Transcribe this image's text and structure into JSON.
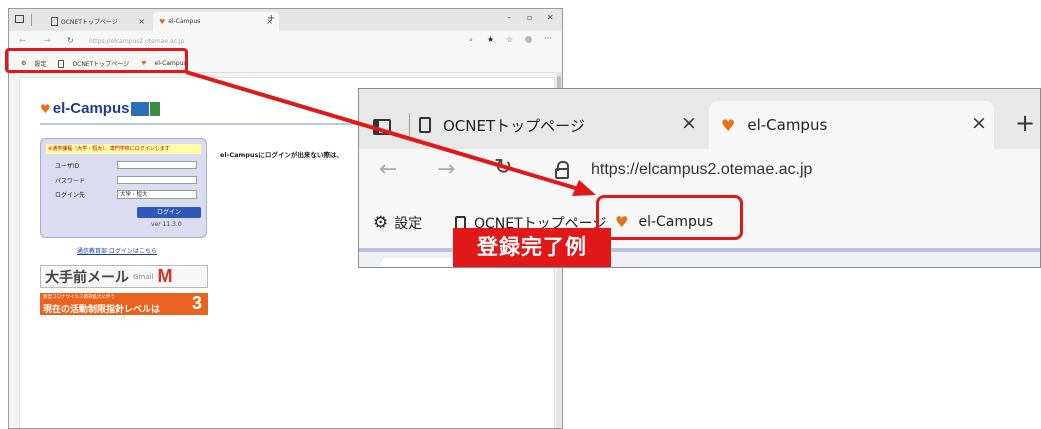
{
  "background_browser": {
    "tabs": [
      {
        "label": "OCNETトップページ"
      },
      {
        "label": "el-Campus"
      }
    ],
    "close_glyph": "×",
    "new_tab_glyph": "+",
    "address": "https://elcampus2.otemae.ac.jp",
    "favorites": [
      {
        "label": "設定",
        "icon": "gear-icon"
      },
      {
        "label": "OCNETトップページ",
        "icon": "page-icon"
      },
      {
        "label": "el-Campus",
        "icon": "el-campus-icon"
      }
    ]
  },
  "elcampus_page": {
    "logo_text": "el-Campus",
    "login": {
      "note": "※通学課程（大学・短大）、専門学校にログインします",
      "user_id_label": "ユーザID",
      "password_label": "パスワード",
      "destination_label": "ログイン先",
      "destination_value": "大学・短大",
      "login_button": "ログイン",
      "version": "ver 11.3.0"
    },
    "right_message": "el-Campusにログインが出来ない際は、",
    "tsushin_link": "通信教育部 ログインはこちら",
    "mail_banner": {
      "title": "大手前メール",
      "gmail": "Gmail",
      "icon": "gmail-icon"
    },
    "covid_banner": {
      "small": "新型コロナウイルス感染拡大に伴う",
      "big": "現在の活動制限指針レベルは",
      "level": "3"
    }
  },
  "zoom_view": {
    "tabs": [
      {
        "label": "OCNETトップページ"
      },
      {
        "label": "el-Campus"
      }
    ],
    "close_glyph": "×",
    "new_tab_glyph": "+",
    "url": "https://elcampus2.otemae.ac.jp",
    "favorites": [
      {
        "label": "設定",
        "icon": "gear-icon"
      },
      {
        "label": "OCNETトップページ",
        "icon": "page-icon"
      },
      {
        "label": "el-Campus",
        "icon": "el-campus-icon"
      }
    ]
  },
  "annotation": {
    "label": "登録完了例",
    "color": "#e01818"
  }
}
